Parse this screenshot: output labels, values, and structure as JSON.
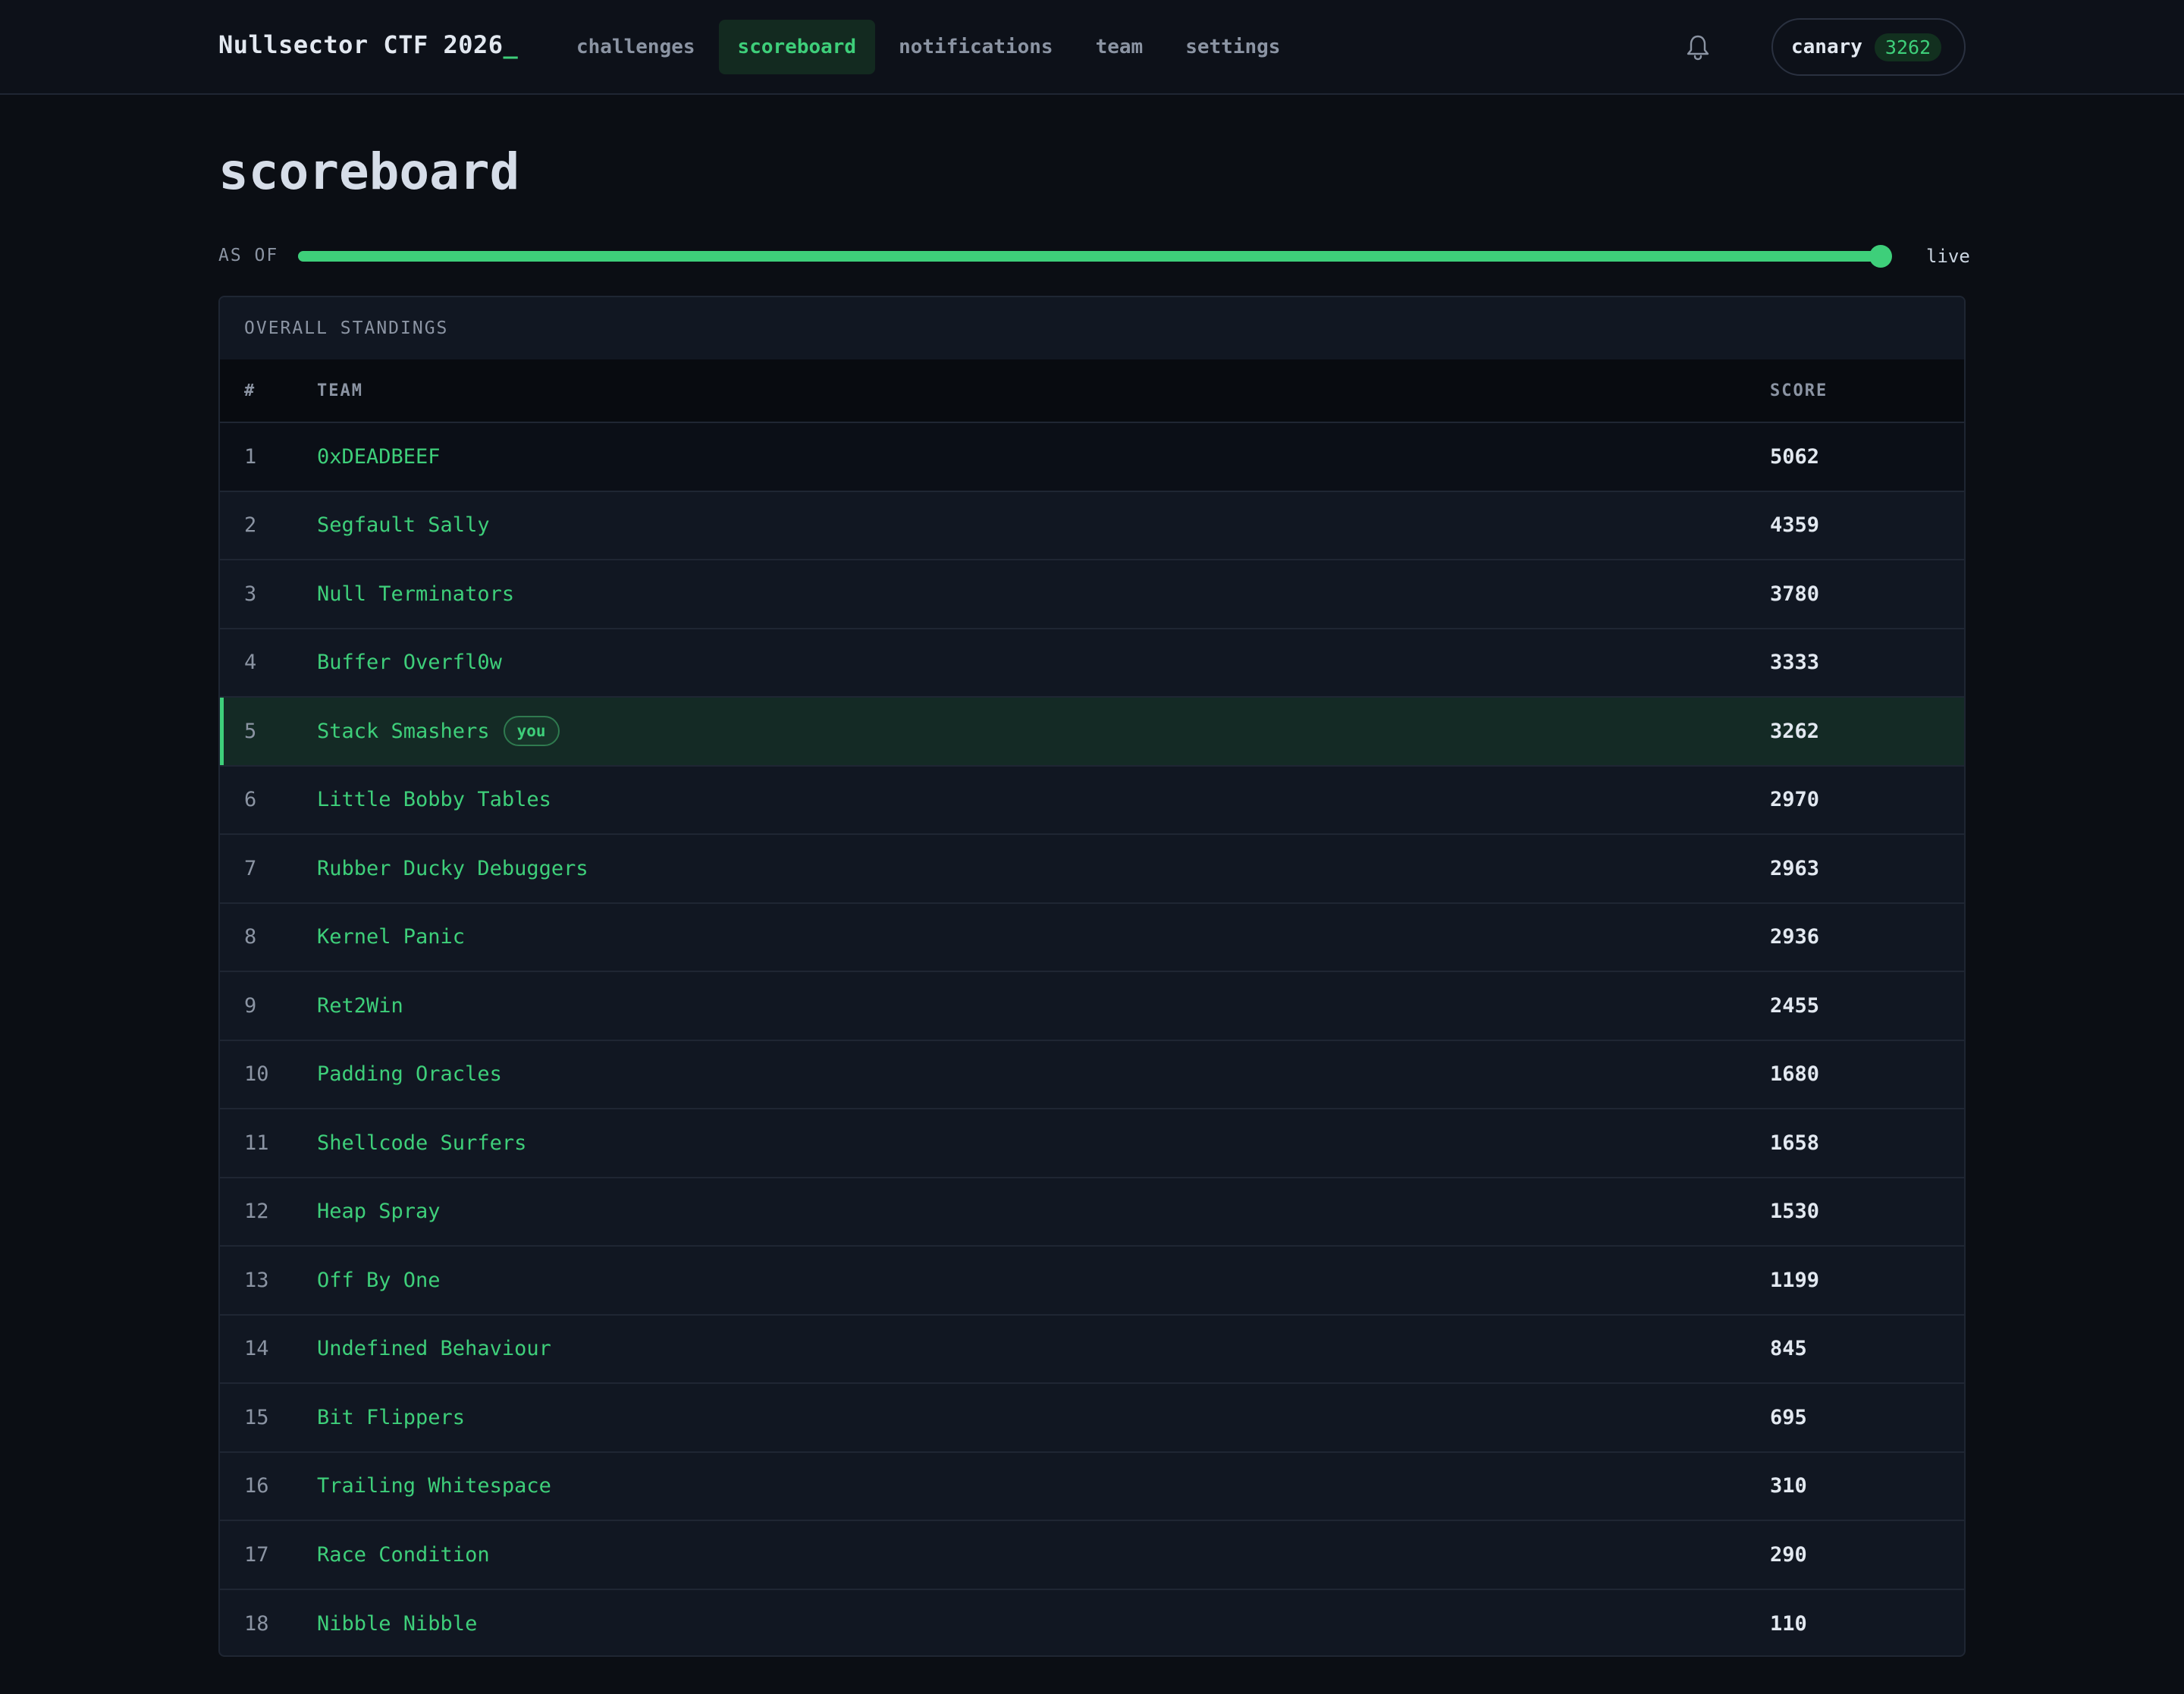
{
  "app": {
    "brand": "Nullsector CTF 2026",
    "brand_cursor": "_"
  },
  "nav": {
    "items": [
      {
        "label": "challenges",
        "active": false
      },
      {
        "label": "scoreboard",
        "active": true
      },
      {
        "label": "notifications",
        "active": false
      },
      {
        "label": "team",
        "active": false
      },
      {
        "label": "settings",
        "active": false
      }
    ],
    "bell_icon": "bell-icon"
  },
  "user": {
    "name": "canary",
    "score": "3262"
  },
  "page": {
    "title": "scoreboard"
  },
  "timeline": {
    "label": "AS OF",
    "value_label": "live",
    "position_fraction": 1.0
  },
  "standings": {
    "title": "OVERALL STANDINGS",
    "columns": {
      "rank": "#",
      "team": "TEAM",
      "score": "SCORE"
    },
    "you_badge": "you",
    "rows": [
      {
        "rank": "1",
        "team": "0xDEADBEEF",
        "score": "5062"
      },
      {
        "rank": "2",
        "team": "Segfault Sally",
        "score": "4359"
      },
      {
        "rank": "3",
        "team": "Null Terminators",
        "score": "3780"
      },
      {
        "rank": "4",
        "team": "Buffer Overfl0w",
        "score": "3333"
      },
      {
        "rank": "5",
        "team": "Stack Smashers",
        "score": "3262",
        "is_you": true
      },
      {
        "rank": "6",
        "team": "Little Bobby Tables",
        "score": "2970"
      },
      {
        "rank": "7",
        "team": "Rubber Ducky Debuggers",
        "score": "2963"
      },
      {
        "rank": "8",
        "team": "Kernel Panic",
        "score": "2936"
      },
      {
        "rank": "9",
        "team": "Ret2Win",
        "score": "2455"
      },
      {
        "rank": "10",
        "team": "Padding Oracles",
        "score": "1680"
      },
      {
        "rank": "11",
        "team": "Shellcode Surfers",
        "score": "1658"
      },
      {
        "rank": "12",
        "team": "Heap Spray",
        "score": "1530"
      },
      {
        "rank": "13",
        "team": "Off By One",
        "score": "1199"
      },
      {
        "rank": "14",
        "team": "Undefined Behaviour",
        "score": "845"
      },
      {
        "rank": "15",
        "team": "Bit Flippers",
        "score": "695"
      },
      {
        "rank": "16",
        "team": "Trailing Whitespace",
        "score": "310"
      },
      {
        "rank": "17",
        "team": "Race Condition",
        "score": "290"
      },
      {
        "rank": "18",
        "team": "Nibble Nibble",
        "score": "110"
      }
    ]
  },
  "colors": {
    "accent": "#3ecf7a",
    "background": "#0b0e14",
    "card": "#111722",
    "highlight_row": "#142a25"
  }
}
